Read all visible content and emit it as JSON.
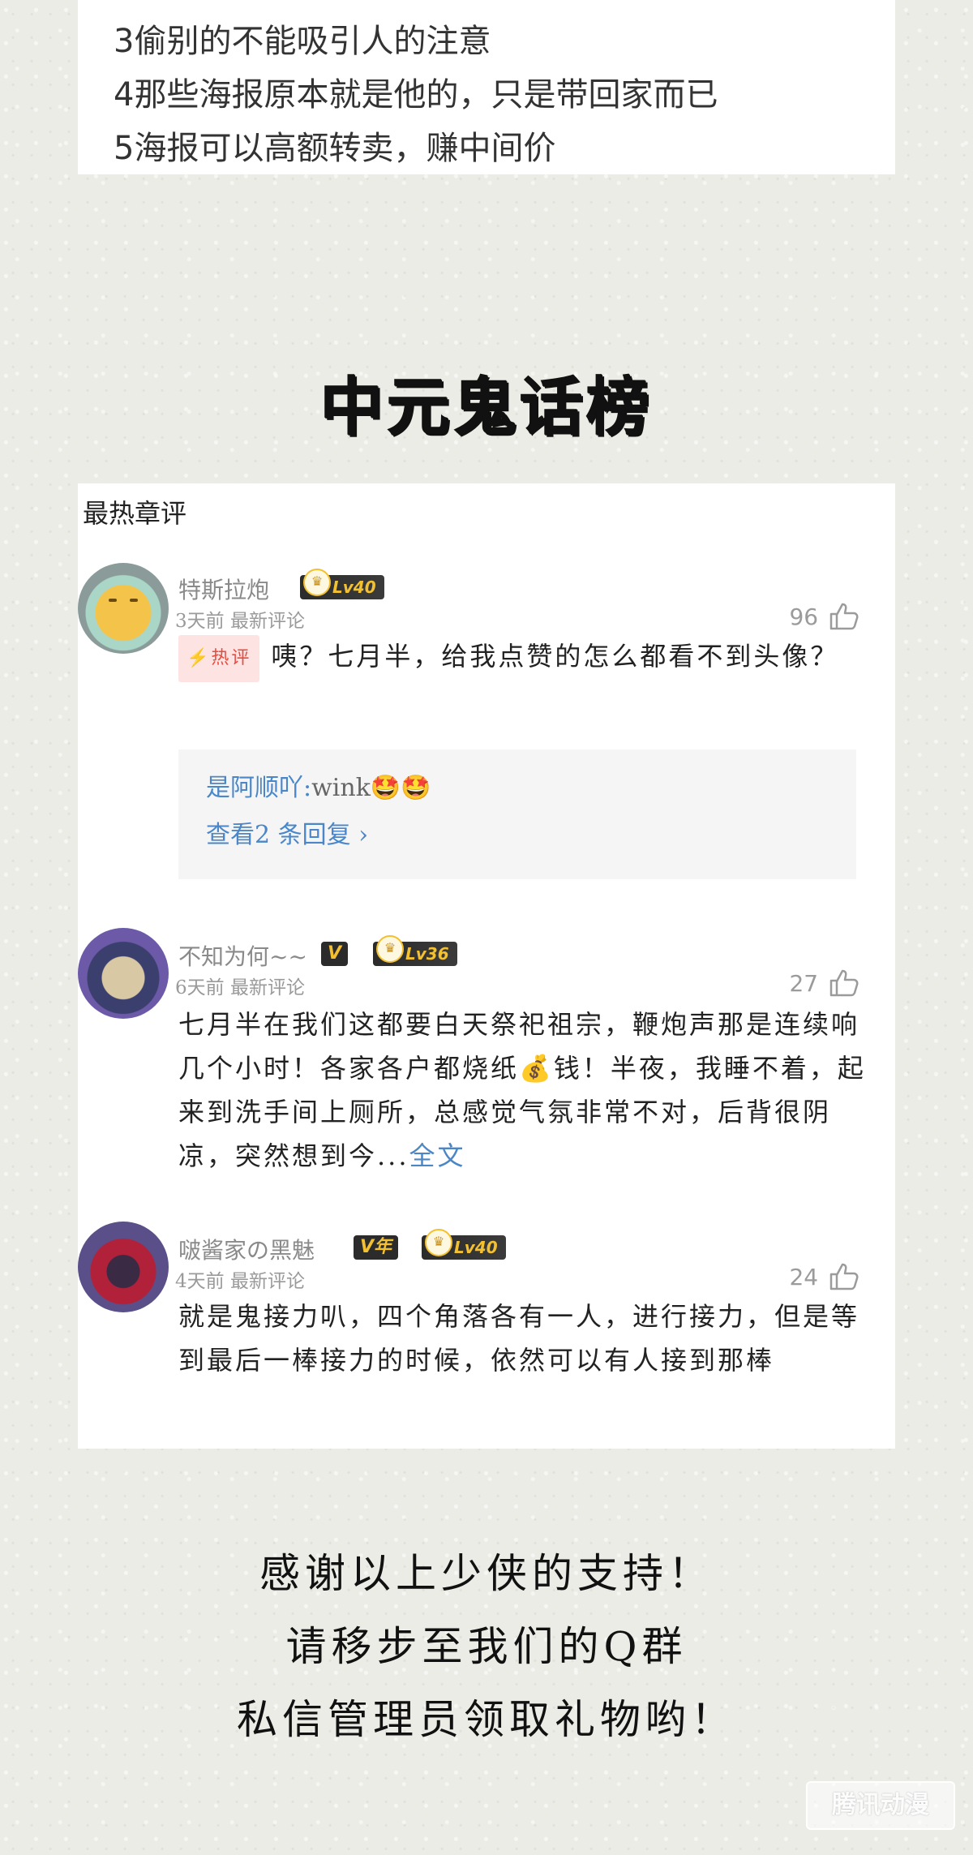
{
  "top_list": {
    "items": [
      "3偷别的不能吸引人的注意",
      "4那些海报原本就是他的，只是带回家而已",
      "5海报可以高额转卖，赚中间价"
    ]
  },
  "headline": "中元鬼话榜",
  "comments_section": {
    "title": "最热章评",
    "comments": [
      {
        "username": "特斯拉炮",
        "level": "Lv40",
        "meta": "3天前 最新评论",
        "likes": "96",
        "hot_badge": "热评",
        "text": "咦？七月半，给我点赞的怎么都看不到头像？",
        "reply_author": "是阿顺吖:",
        "reply_text": "wink🤩🤩",
        "view_replies": "查看2 条回复 ›"
      },
      {
        "username": "不知为何~~",
        "vip": "V",
        "level": "Lv36",
        "meta": "6天前 最新评论",
        "likes": "27",
        "text": "七月半在我们这都要白天祭祀祖宗，鞭炮声那是连续响几个小时！各家各户都烧纸💰钱！半夜，我睡不着，起来到洗手间上厕所，总感觉气氛非常不对，后背很阴凉，突然想到今...",
        "full_link": "全文"
      },
      {
        "username": "啵酱家の黑魅",
        "vip": "V年",
        "level": "Lv40",
        "meta": "4天前 最新评论",
        "likes": "24",
        "text": "就是鬼接力叭，四个角落各有一人，进行接力，但是等到最后一棒接力的时候，依然可以有人接到那棒"
      }
    ]
  },
  "thanks": {
    "line1": "感谢以上少侠的支持！",
    "line2": "请移步至我们的Q群",
    "line3": "私信管理员领取礼物哟！"
  },
  "watermark": "腾讯动漫"
}
